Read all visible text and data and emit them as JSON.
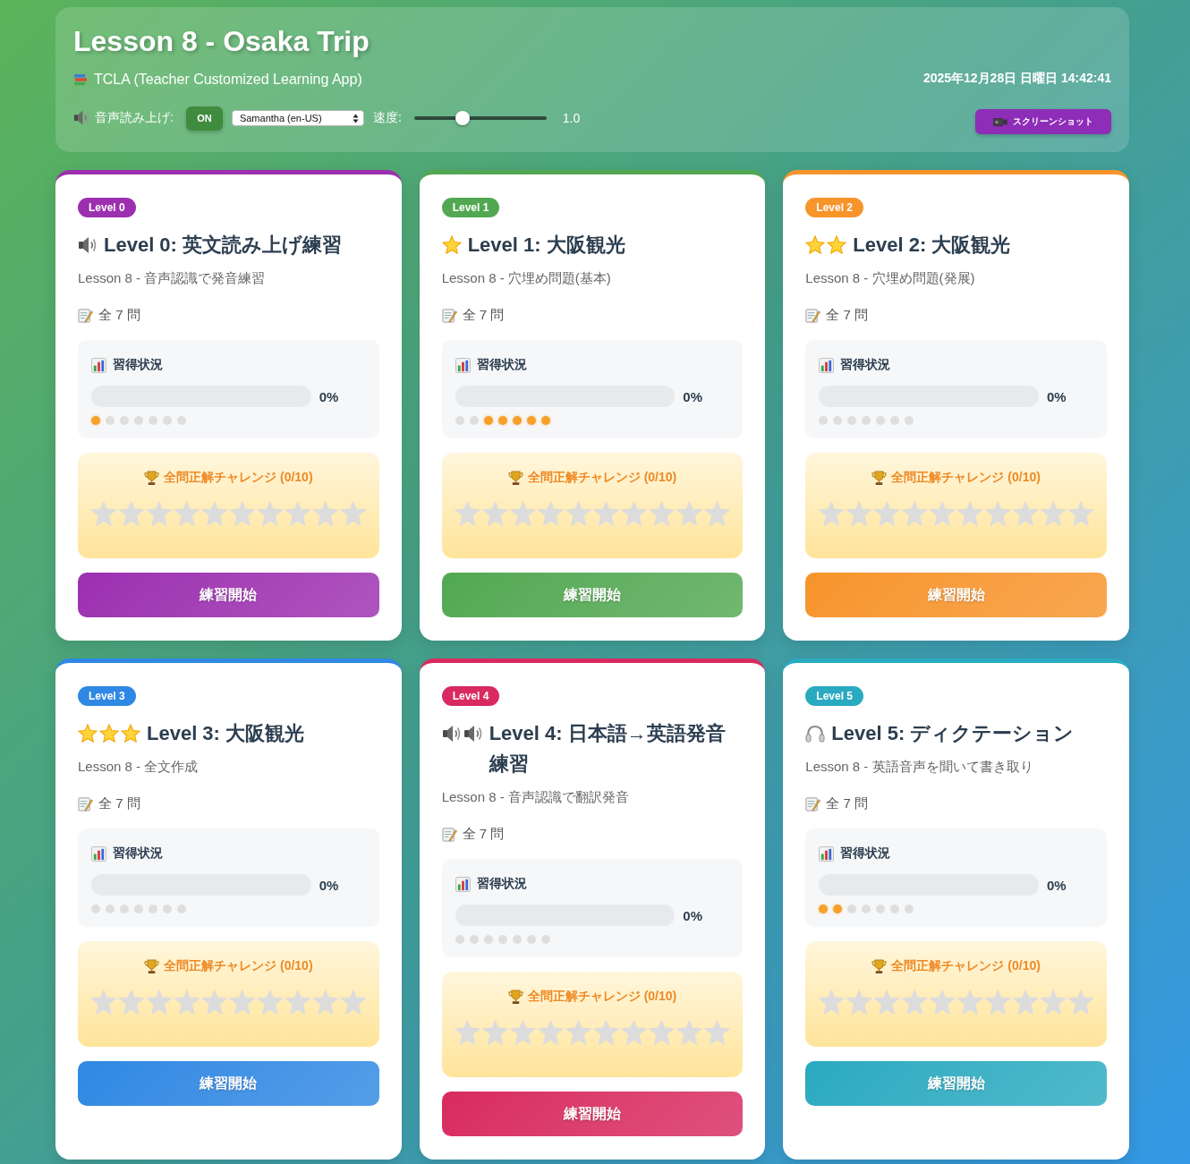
{
  "header": {
    "title": "Lesson 8 - Osaka Trip",
    "app_name": "TCLA (Teacher Customized Learning App)",
    "datetime": "2025年12月28日 日曜日 14:42:41",
    "tts": {
      "label": "音声読み上げ:",
      "toggle": {
        "label": "ON",
        "on": true
      },
      "voice": "Samantha (en-US)",
      "speed_label": "速度:",
      "speed": {
        "level": 0.35
      },
      "speed_reading": "1.0"
    },
    "screenshot_button": "スクリーンショット"
  },
  "cards": [
    {
      "badge": "Level 0",
      "color": "#9c2fb0",
      "title_icons": [
        {
          "kind": "speaker"
        }
      ],
      "title": "Level 0: 英文読み上げ練習",
      "subtitle": "Lesson 8 - 音声認識で発音練習",
      "count": "全 7 問",
      "progress": {
        "label": "習得状況",
        "level": 0,
        "reading": "0%",
        "dots": [
          {
            "done": true
          },
          {
            "done": false
          },
          {
            "done": false
          },
          {
            "done": false
          },
          {
            "done": false
          },
          {
            "done": false
          },
          {
            "done": false
          }
        ]
      },
      "challenge": {
        "title": "全問正解チャレンジ (0/10)",
        "stars": 0
      },
      "button": "練習開始"
    },
    {
      "badge": "Level 1",
      "color": "#52a852",
      "title_icons": [
        {
          "kind": "star"
        }
      ],
      "title": "Level 1: 大阪観光",
      "subtitle": "Lesson 8 - 穴埋め問題(基本)",
      "count": "全 7 問",
      "progress": {
        "label": "習得状況",
        "level": 0,
        "reading": "0%",
        "dots": [
          {
            "done": false
          },
          {
            "done": false
          },
          {
            "done": true
          },
          {
            "done": true
          },
          {
            "done": true
          },
          {
            "done": true
          },
          {
            "done": true
          }
        ]
      },
      "challenge": {
        "title": "全問正解チャレンジ (0/10)",
        "stars": 0
      },
      "button": "練習開始"
    },
    {
      "badge": "Level 2",
      "color": "#f7942a",
      "title_icons": [
        {
          "kind": "star"
        },
        {
          "kind": "star"
        }
      ],
      "title": "Level 2: 大阪観光",
      "subtitle": "Lesson 8 - 穴埋め問題(発展)",
      "count": "全 7 問",
      "progress": {
        "label": "習得状況",
        "level": 0,
        "reading": "0%",
        "dots": [
          {
            "done": false
          },
          {
            "done": false
          },
          {
            "done": false
          },
          {
            "done": false
          },
          {
            "done": false
          },
          {
            "done": false
          },
          {
            "done": false
          }
        ]
      },
      "challenge": {
        "title": "全問正解チャレンジ (0/10)",
        "stars": 0
      },
      "button": "練習開始"
    },
    {
      "badge": "Level 3",
      "color": "#2f88e3",
      "title_icons": [
        {
          "kind": "star"
        },
        {
          "kind": "star"
        },
        {
          "kind": "star"
        }
      ],
      "title": "Level 3: 大阪観光",
      "subtitle": "Lesson 8 - 全文作成",
      "count": "全 7 問",
      "progress": {
        "label": "習得状況",
        "level": 0,
        "reading": "0%",
        "dots": [
          {
            "done": false
          },
          {
            "done": false
          },
          {
            "done": false
          },
          {
            "done": false
          },
          {
            "done": false
          },
          {
            "done": false
          },
          {
            "done": false
          }
        ]
      },
      "challenge": {
        "title": "全問正解チャレンジ (0/10)",
        "stars": 0
      },
      "button": "練習開始"
    },
    {
      "badge": "Level 4",
      "color": "#d82a60",
      "title_icons": [
        {
          "kind": "speaker"
        },
        {
          "kind": "speaker"
        }
      ],
      "title": "Level 4: 日本語→英語発音練習",
      "subtitle": "Lesson 8 - 音声認識で翻訳発音",
      "count": "全 7 問",
      "progress": {
        "label": "習得状況",
        "level": 0,
        "reading": "0%",
        "dots": [
          {
            "done": false
          },
          {
            "done": false
          },
          {
            "done": false
          },
          {
            "done": false
          },
          {
            "done": false
          },
          {
            "done": false
          },
          {
            "done": false
          }
        ]
      },
      "challenge": {
        "title": "全問正解チャレンジ (0/10)",
        "stars": 0
      },
      "button": "練習開始"
    },
    {
      "badge": "Level 5",
      "color": "#29aac0",
      "title_icons": [
        {
          "kind": "headphones"
        }
      ],
      "title": "Level 5: ディクテーション",
      "subtitle": "Lesson 8 - 英語音声を聞いて書き取り",
      "count": "全 7 問",
      "progress": {
        "label": "習得状況",
        "level": 0,
        "reading": "0%",
        "dots": [
          {
            "done": true
          },
          {
            "done": true
          },
          {
            "done": false
          },
          {
            "done": false
          },
          {
            "done": false
          },
          {
            "done": false
          },
          {
            "done": false
          }
        ]
      },
      "challenge": {
        "title": "全問正解チャレンジ (0/10)",
        "stars": 0
      },
      "button": "練習開始"
    }
  ]
}
